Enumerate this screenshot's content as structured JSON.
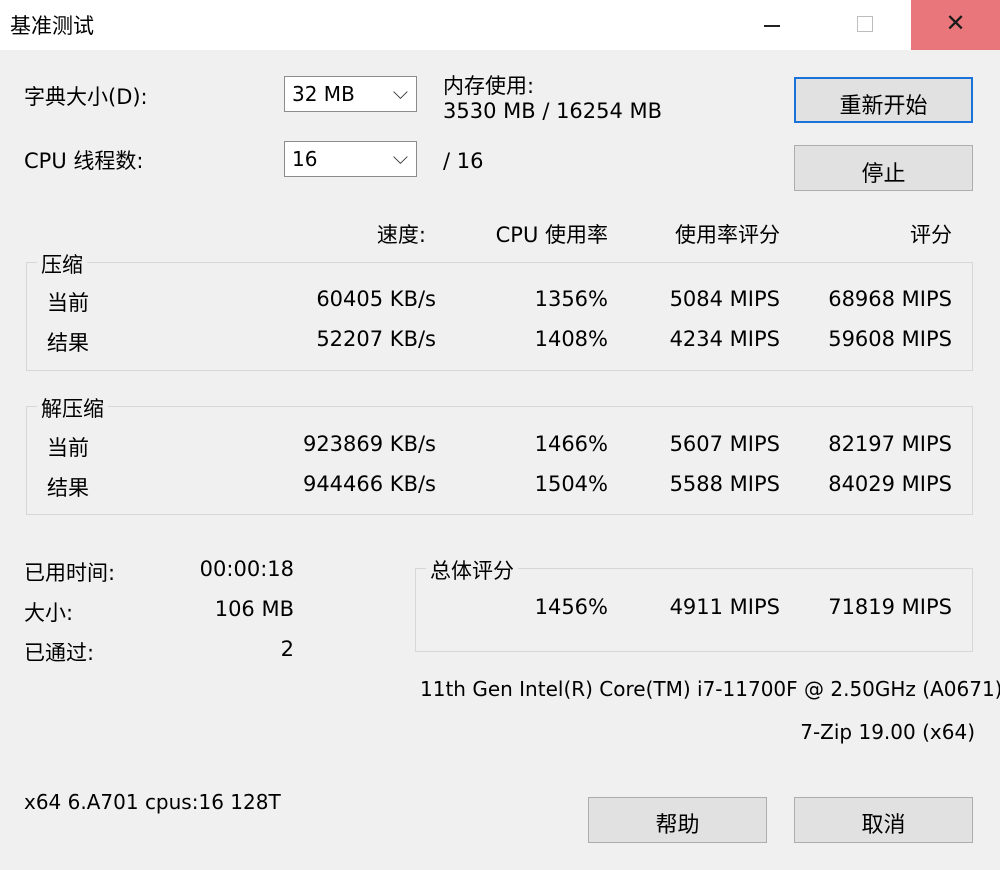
{
  "window": {
    "title": "基准测试",
    "min_symbol": "",
    "close_symbol": "✕"
  },
  "dict": {
    "label": "字典大小(D):",
    "value": "32 MB"
  },
  "threads": {
    "label": "CPU 线程数:",
    "value": "16",
    "max": "/ 16"
  },
  "memory": {
    "label": "内存使用:",
    "value": "3530 MB / 16254 MB"
  },
  "buttons": {
    "restart": "重新开始",
    "stop": "停止",
    "help": "帮助",
    "cancel": "取消"
  },
  "headers": {
    "speed": "速度:",
    "cpu_usage": "CPU 使用率",
    "usage_rating": "使用率评分",
    "rating": "评分"
  },
  "compress": {
    "title": "压缩",
    "rows": [
      {
        "label": "当前",
        "speed": "60405 KB/s",
        "usage": "1356%",
        "usage_rating": "5084 MIPS",
        "rating": "68968 MIPS"
      },
      {
        "label": "结果",
        "speed": "52207 KB/s",
        "usage": "1408%",
        "usage_rating": "4234 MIPS",
        "rating": "59608 MIPS"
      }
    ]
  },
  "decompress": {
    "title": "解压缩",
    "rows": [
      {
        "label": "当前",
        "speed": "923869 KB/s",
        "usage": "1466%",
        "usage_rating": "5607 MIPS",
        "rating": "82197 MIPS"
      },
      {
        "label": "结果",
        "speed": "944466 KB/s",
        "usage": "1504%",
        "usage_rating": "5588 MIPS",
        "rating": "84029 MIPS"
      }
    ]
  },
  "stats": {
    "elapsed_label": "已用时间:",
    "elapsed_value": "00:00:18",
    "size_label": "大小:",
    "size_value": "106 MB",
    "passes_label": "已通过:",
    "passes_value": "2"
  },
  "total": {
    "title": "总体评分",
    "usage": "1456%",
    "usage_rating": "4911 MIPS",
    "rating": "71819 MIPS"
  },
  "cpu_name": "11th Gen Intel(R) Core(TM) i7-11700F @ 2.50GHz (A0671)",
  "version": "7-Zip 19.00 (x64)",
  "sysinfo": "x64 6.A701 cpus:16 128T"
}
